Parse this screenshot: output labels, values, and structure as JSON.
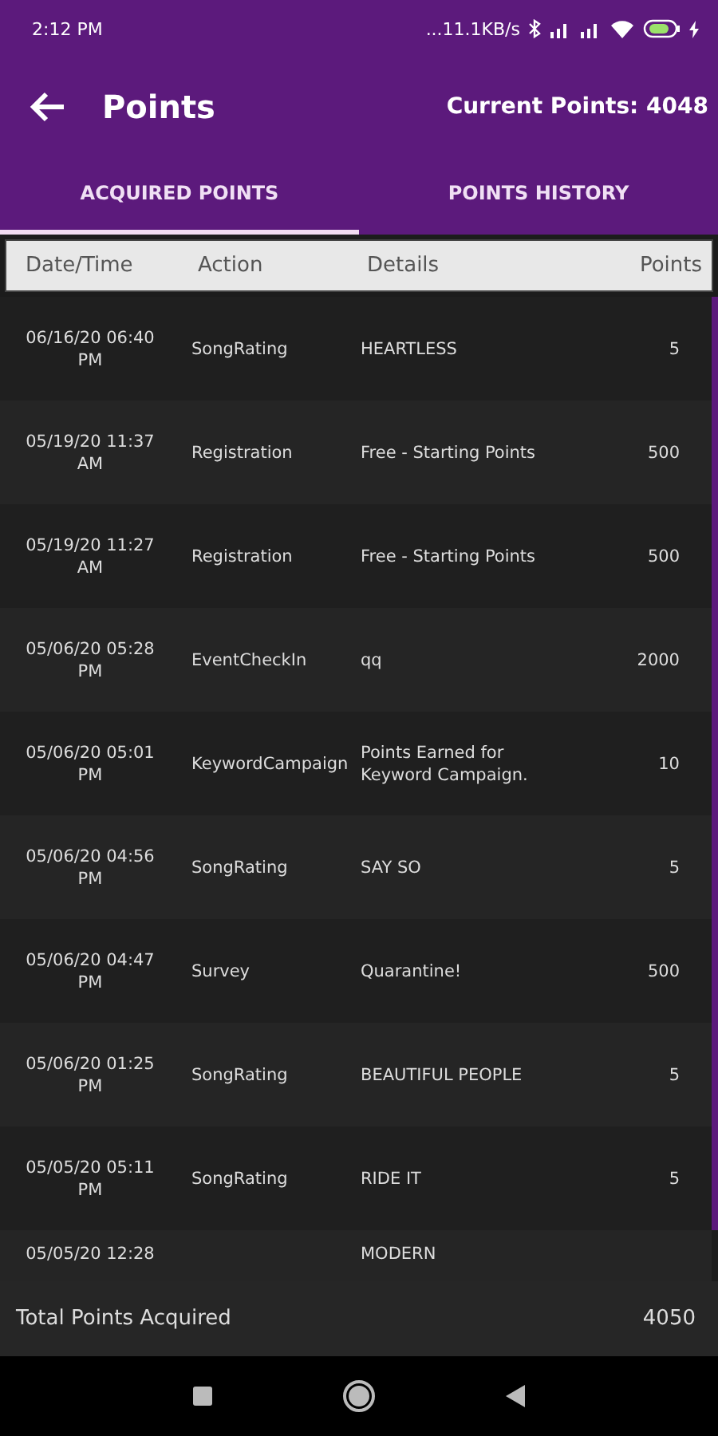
{
  "status_bar": {
    "time": "2:12 PM",
    "network_speed": "...11.1KB/s"
  },
  "app_bar": {
    "title": "Points",
    "current_points": "Current Points: 4048"
  },
  "tabs": [
    {
      "label": "ACQUIRED POINTS",
      "selected": true
    },
    {
      "label": "POINTS HISTORY",
      "selected": false
    }
  ],
  "table": {
    "columns": [
      "Date/Time",
      "Action",
      "Details",
      "Points"
    ],
    "rows": [
      {
        "kind": "full",
        "date": "06/16/20 06:40 PM",
        "action": "SongRating",
        "details": "HEARTLESS",
        "points": "5"
      },
      {
        "kind": "full",
        "date": "05/19/20 11:37 AM",
        "action": "Registration",
        "details": "Free - Starting Points",
        "points": "500"
      },
      {
        "kind": "full",
        "date": "05/19/20 11:27 AM",
        "action": "Registration",
        "details": "Free - Starting Points",
        "points": "500"
      },
      {
        "kind": "full",
        "date": "05/06/20 05:28 PM",
        "action": "EventCheckIn",
        "details": "qq",
        "points": "2000"
      },
      {
        "kind": "full",
        "date": "05/06/20 05:01 PM",
        "action": "KeywordCampaign",
        "details": "Points Earned for Keyword Campaign.",
        "points": "10"
      },
      {
        "kind": "full",
        "date": "05/06/20 04:56 PM",
        "action": "SongRating",
        "details": "SAY SO",
        "points": "5"
      },
      {
        "kind": "full",
        "date": "05/06/20 04:47 PM",
        "action": "Survey",
        "details": "Quarantine!",
        "points": "500"
      },
      {
        "kind": "full",
        "date": "05/06/20 01:25 PM",
        "action": "SongRating",
        "details": "BEAUTIFUL PEOPLE",
        "points": "5"
      },
      {
        "kind": "full",
        "date": "05/05/20 05:11 PM",
        "action": "SongRating",
        "details": "RIDE IT",
        "points": "5"
      },
      {
        "kind": "cut",
        "date": "05/05/20 12:28",
        "details": "MODERN"
      }
    ]
  },
  "footer": {
    "label": "Total Points Acquired",
    "total": "4050"
  }
}
